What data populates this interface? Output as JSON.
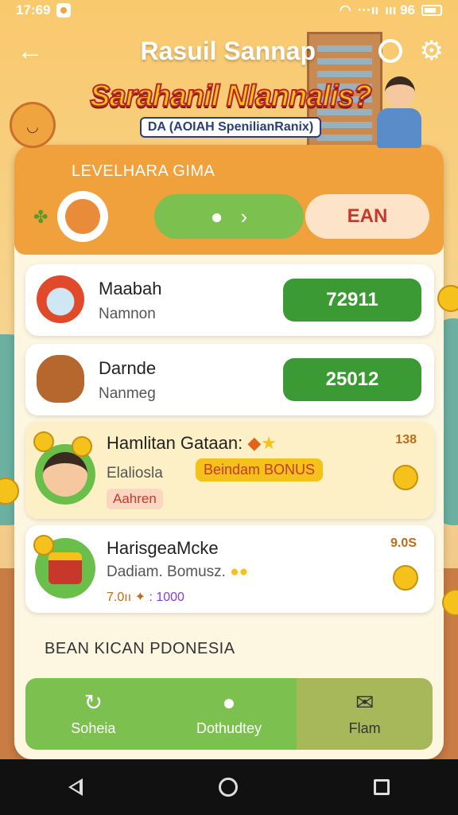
{
  "status_bar": {
    "time": "17:69",
    "signal": "···ıı",
    "battery_text": "ııı 96"
  },
  "header": {
    "title": "Rasuil Sannap"
  },
  "banner": {
    "title": "Sarahanil Nlannalis?",
    "subtitle": "DA (AOIAH SpenilianRanix)"
  },
  "level": {
    "label": "LEVELHARA GIMA",
    "toggle_arrow": "›",
    "ean_label": "EAN"
  },
  "items": [
    {
      "name": "Maabah",
      "sub": "Namnon",
      "value": "72911"
    },
    {
      "name": "Darnde",
      "sub": "Nanmeg",
      "value": "25012"
    },
    {
      "name": "Hamlitan Gataan:",
      "sub": "Elaliosla",
      "bonus": "Beindam BONUS",
      "tag": "Aahren",
      "value": "138"
    },
    {
      "name": "HarisgeaMcke",
      "sub": "Dadiam. Bomusz.",
      "reward_a": "7.0ıı",
      "reward_b": ": 1000",
      "value": "9.0S"
    }
  ],
  "section_label": "BEAN KICAN PDONESIA",
  "tabs": [
    {
      "label": "Soheia",
      "icon": "refresh-icon"
    },
    {
      "label": "Dothudtey",
      "icon": "chat-icon"
    },
    {
      "label": "Flam",
      "icon": "ticket-icon"
    }
  ],
  "colors": {
    "accent_orange": "#f0a13b",
    "green": "#3b9a34",
    "light_green": "#7cc150"
  }
}
